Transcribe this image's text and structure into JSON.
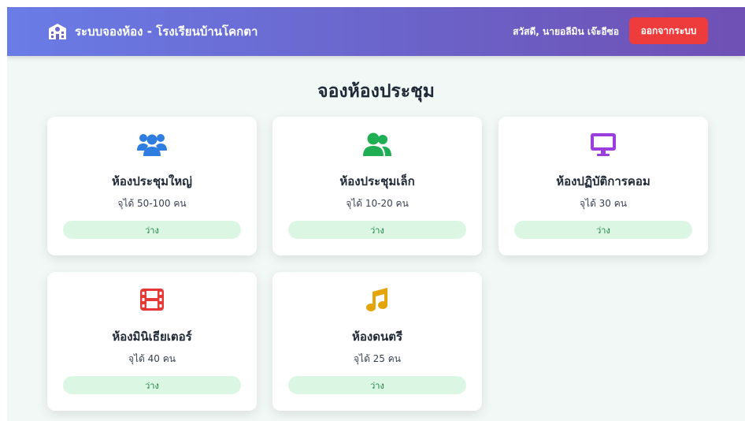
{
  "header": {
    "title": "ระบบจองห้อง - โรงเรียนบ้านโคกตา",
    "greeting": "สวัสดี, นายอลีมิน เจ๊ะอีซอ",
    "logout_label": "ออกจากระบบ",
    "icon": "school-icon"
  },
  "main": {
    "title": "จองห้องประชุม"
  },
  "colors": {
    "header_gradient": [
      "#6a7ce6",
      "#6f50b4"
    ],
    "logout": "#ee3b3b",
    "status_bg": "#dbf7e4"
  },
  "rooms": [
    {
      "name": "ห้องประชุมใหญ่",
      "capacity": "จุได้ 50-100 คน",
      "status": "ว่าง",
      "icon": "users-group-icon",
      "icon_color": "#2f7de1"
    },
    {
      "name": "ห้องประชุมเล็ก",
      "capacity": "จุได้ 10-20 คน",
      "status": "ว่าง",
      "icon": "users-icon",
      "icon_color": "#1fae54"
    },
    {
      "name": "ห้องปฏิบัติการคอม",
      "capacity": "จุได้ 30 คน",
      "status": "ว่าง",
      "icon": "desktop-icon",
      "icon_color": "#9b3ee0"
    },
    {
      "name": "ห้องมินิเธียเตอร์",
      "capacity": "จุได้ 40 คน",
      "status": "ว่าง",
      "icon": "film-icon",
      "icon_color": "#e53935"
    },
    {
      "name": "ห้องดนตรี",
      "capacity": "จุได้ 25 คน",
      "status": "ว่าง",
      "icon": "music-icon",
      "icon_color": "#e5a50a"
    }
  ]
}
